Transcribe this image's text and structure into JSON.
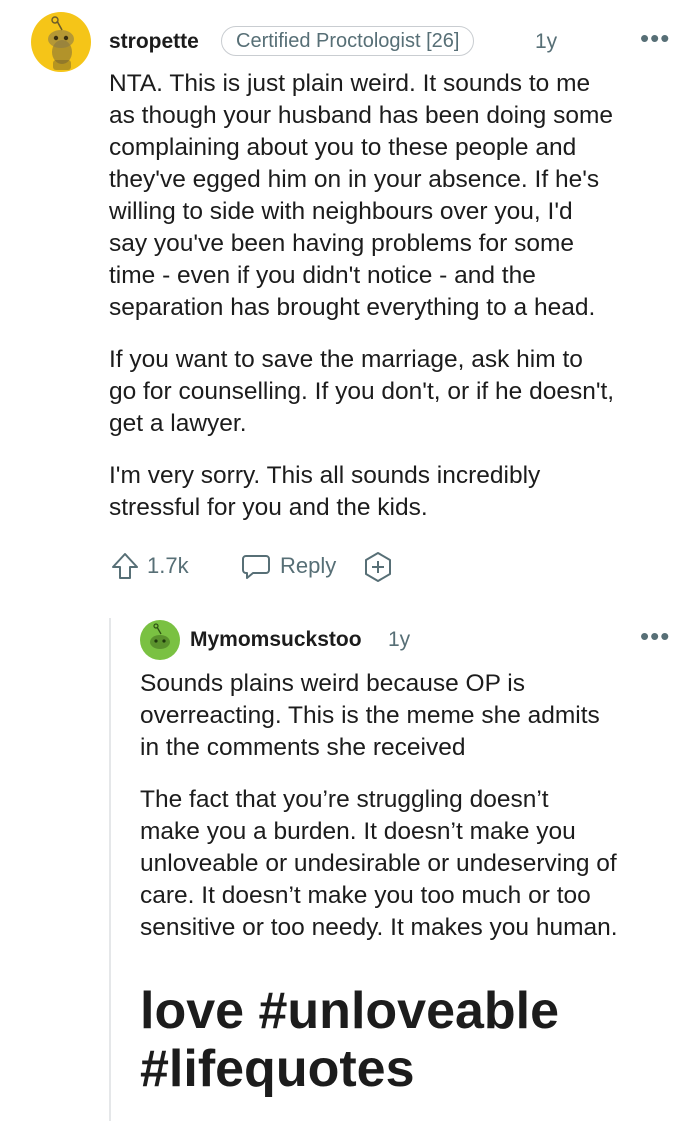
{
  "top_comment": {
    "username": "stropette",
    "flair": "Certified Proctologist [26]",
    "age": "1y",
    "more": "•••",
    "paragraphs": [
      "NTA. This is just plain weird. It sounds to me\nas though your husband has been doing some\ncomplaining about you to these people and\nthey've egged him on in your absence. If he's\nwilling to side with neighbours over you, I'd\nsay you've been having problems for some\ntime - even if you didn't notice - and the\nseparation has brought everything to a head.",
      "If you want to save the marriage, ask him to\ngo for counselling. If you don't, or if he doesn't,\nget a lawyer.",
      "I'm very sorry. This all sounds incredibly\nstressful for you and the kids."
    ],
    "actions": {
      "upvotes": "1.7k",
      "reply_label": "Reply"
    },
    "avatar_color": "#f5c518"
  },
  "reply_comment": {
    "username": "Mymomsuckstoo",
    "age": "1y",
    "more": "•••",
    "paragraphs": [
      "Sounds plains weird because OP is\noverreacting. This is the meme she admits\nin the comments she received",
      "The fact that you’re struggling doesn’t\nmake you a burden. It doesn’t make you\nunloveable or undesirable or undeserving of\ncare. It doesn’t make you too much or too\nsensitive or too needy. It makes you human."
    ],
    "meme_text": "love #unloveable\n#lifequotes",
    "avatar_color": "#7ac142"
  }
}
